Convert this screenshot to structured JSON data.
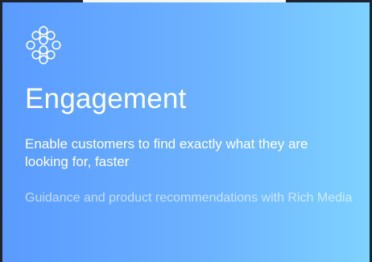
{
  "card": {
    "icon": "hexagon-network-icon",
    "title": "Engagement",
    "subtitle": "Enable customers to find exactly what they are looking for, faster",
    "description": "Guidance and product recommendations with Rich Media",
    "colors": {
      "gradient_start": "#5a9bff",
      "gradient_end": "#7fd2ff",
      "text": "#ffffff"
    }
  }
}
